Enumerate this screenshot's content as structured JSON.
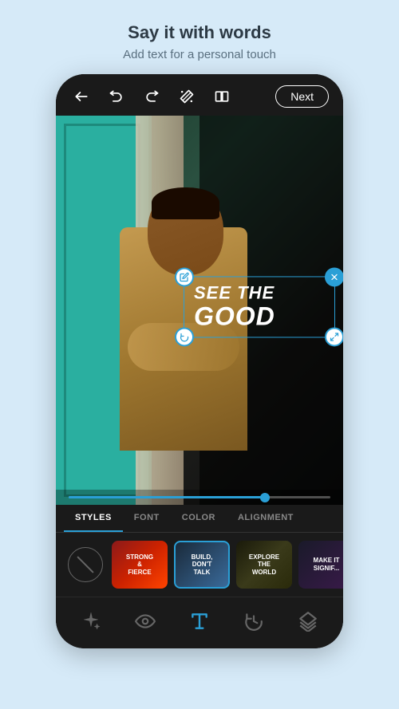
{
  "header": {
    "title": "Say it with words",
    "subtitle": "Add text for a personal touch"
  },
  "toolbar": {
    "next_label": "Next",
    "back_icon": "back-arrow",
    "undo_icon": "undo-arrow",
    "redo_icon": "redo-arrow",
    "magic_icon": "magic-wand",
    "compare_icon": "compare-view"
  },
  "text_overlay": {
    "line1": "SEE THE",
    "line2": "GOOD"
  },
  "tabs": {
    "items": [
      {
        "label": "STYLES",
        "active": true
      },
      {
        "label": "FONT",
        "active": false
      },
      {
        "label": "COLOR",
        "active": false
      },
      {
        "label": "ALIGNMENT",
        "active": false
      }
    ]
  },
  "style_items": [
    {
      "id": "none",
      "label": ""
    },
    {
      "id": "strong-fierce",
      "label": "STRONG & FIERCE"
    },
    {
      "id": "build-dont-talk",
      "label": "BUILD, DON'T TALK",
      "selected": true
    },
    {
      "id": "explore-world",
      "label": "EXPLORE THE WORLD"
    },
    {
      "id": "make-it-signif",
      "label": "MAKE IT SIGNIF..."
    }
  ],
  "bottom_nav": {
    "items": [
      {
        "icon": "magic-stars",
        "active": false
      },
      {
        "icon": "eye-view",
        "active": false
      },
      {
        "icon": "text-T",
        "active": true
      },
      {
        "icon": "history",
        "active": false
      },
      {
        "icon": "layers",
        "active": false
      }
    ]
  },
  "slider": {
    "value": 75,
    "max": 100
  },
  "colors": {
    "accent": "#2a9fd6",
    "bg_dark": "#1a1a1a",
    "bg_light": "#d6eaf8"
  }
}
